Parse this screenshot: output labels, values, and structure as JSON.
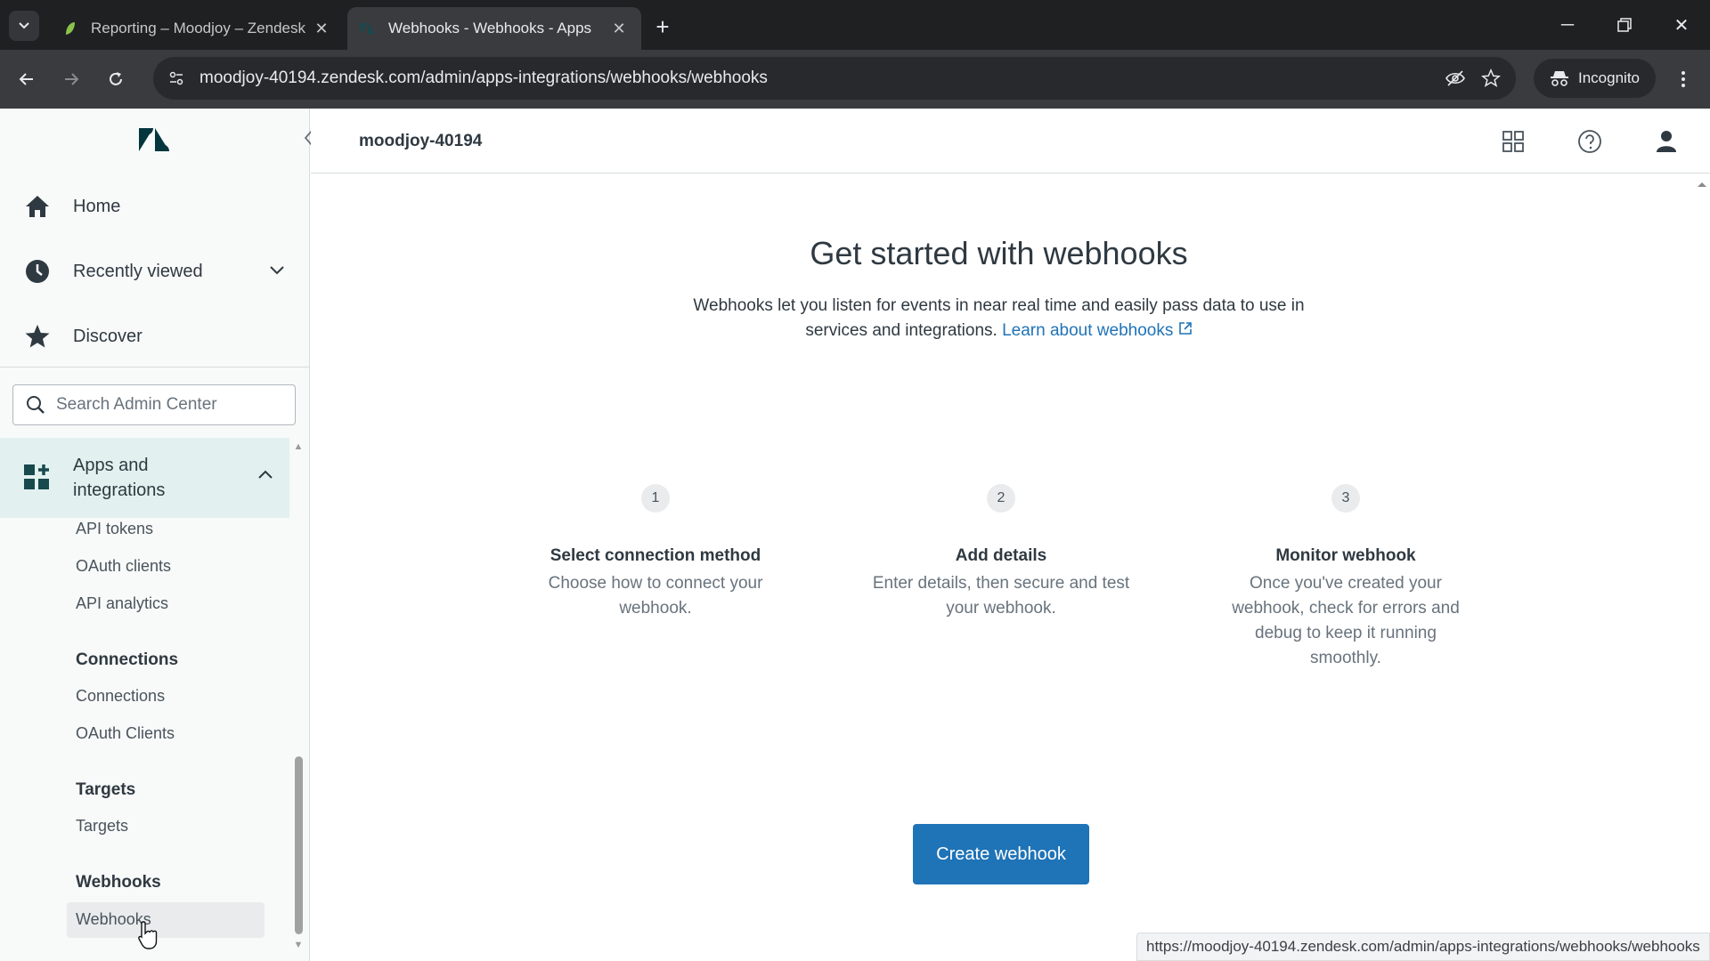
{
  "browser": {
    "tabs": [
      {
        "title": "Reporting – Moodjoy – Zendesk",
        "active": false
      },
      {
        "title": "Webhooks - Webhooks - Apps",
        "active": true
      }
    ],
    "url": "moodjoy-40194.zendesk.com/admin/apps-integrations/webhooks/webhooks",
    "incognito_label": "Incognito",
    "status_url": "https://moodjoy-40194.zendesk.com/admin/apps-integrations/webhooks/webhooks"
  },
  "sidebar": {
    "nav": [
      {
        "label": "Home",
        "icon": "home-icon"
      },
      {
        "label": "Recently viewed",
        "icon": "clock-icon"
      },
      {
        "label": "Discover",
        "icon": "star-icon"
      }
    ],
    "search_placeholder": "Search Admin Center",
    "section": {
      "label": "Apps and integrations"
    },
    "groups": {
      "api": [
        "API tokens",
        "OAuth clients",
        "API analytics"
      ],
      "connections_header": "Connections",
      "connections": [
        "Connections",
        "OAuth Clients"
      ],
      "targets_header": "Targets",
      "targets": [
        "Targets"
      ],
      "webhooks_header": "Webhooks",
      "webhooks": [
        "Webhooks"
      ]
    }
  },
  "header": {
    "account": "moodjoy-40194"
  },
  "main": {
    "title": "Get started with webhooks",
    "description_line1": "Webhooks let you listen for events in near real time and easily pass data to use in",
    "description_line2": "services and integrations.",
    "learn_link": "Learn about webhooks",
    "steps": [
      {
        "num": "1",
        "title": "Select connection method",
        "desc_l1": "Choose how to connect your",
        "desc_l2": "webhook.",
        "desc_l3": "",
        "desc_l4": ""
      },
      {
        "num": "2",
        "title": "Add details",
        "desc_l1": "Enter details, then secure and test",
        "desc_l2": "your webhook.",
        "desc_l3": "",
        "desc_l4": ""
      },
      {
        "num": "3",
        "title": "Monitor webhook",
        "desc_l1": "Once you've created your",
        "desc_l2": "webhook, check for errors and",
        "desc_l3": "debug to keep it running",
        "desc_l4": "smoothly."
      }
    ],
    "create_button": "Create webhook"
  },
  "colors": {
    "accent": "#1f73b7",
    "active_section": "#e2f1ef"
  }
}
